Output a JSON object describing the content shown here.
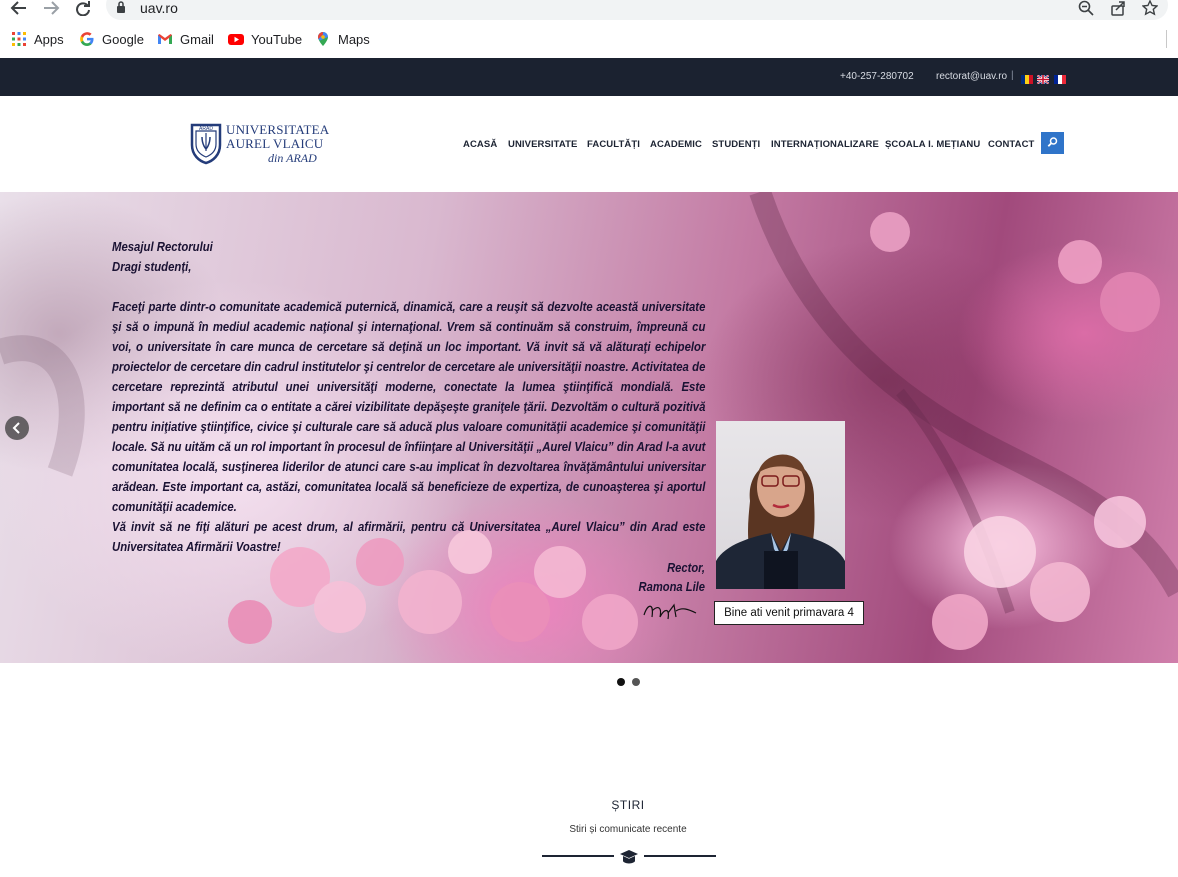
{
  "browser": {
    "url": "uav.ro",
    "bookmarks": [
      {
        "label": "Apps",
        "icon": "apps-grid-icon"
      },
      {
        "label": "Google",
        "icon": "google-icon"
      },
      {
        "label": "Gmail",
        "icon": "gmail-icon"
      },
      {
        "label": "YouTube",
        "icon": "youtube-icon"
      },
      {
        "label": "Maps",
        "icon": "maps-icon"
      }
    ]
  },
  "topbar": {
    "phone": "+40-257-280702",
    "email": "rectorat@uav.ro",
    "separator": "|",
    "languages": [
      "ro",
      "en",
      "fr"
    ]
  },
  "logo": {
    "line1": "UNIVERSITATEA",
    "line2": "AUREL VLAICU",
    "line3": "din ARAD",
    "emblem_text": "ARAD"
  },
  "menu": [
    "ACASĂ",
    "UNIVERSITATE",
    "FACULTĂȚI",
    "ACADEMIC",
    "STUDENȚI",
    "INTERNAȚIONALIZARE",
    "ȘCOALA I. MEȚIANU",
    "CONTACT"
  ],
  "hero": {
    "heading": "Mesajul Rectorului",
    "greeting": "Dragi studenți,",
    "body": "Faceţi parte dintr-o comunitate academică puternică, dinamică, care a reuşit să dezvolte această universitate şi să o impună în mediul academic naţional şi internaţional. Vrem să continuăm să construim, împreună cu voi, o universitate în care munca de cercetare să deţină un loc important. Vă invit să vă alăturaţi echipelor proiectelor de cercetare din cadrul institutelor şi centrelor de cercetare ale universităţii noastre.  Activitatea de cercetare reprezintă atributul unei universităţi moderne, conectate la lumea ştiinţifică mondială. Este important să ne definim ca o entitate a cărei vizibilitate depăşeşte graniţele ţării. Dezvoltăm o cultură pozitivă pentru iniţiative ştiinţifice, civice şi culturale care să aducă plus valoare comunităţii academice şi comunităţii locale. Să nu uităm că un rol important în procesul de înfiinţare al Universităţii „Aurel Vlaicu” din Arad l-a avut comunitatea locală, susţinerea liderilor de atunci care s-au implicat în dezvoltarea învăţământului universitar arădean. Este important ca, astăzi, comunitatea locală să beneficieze de expertiza, de cunoaşterea şi aportul comunităţii academice.",
    "closing": "Vă invit să ne fiţi alături pe acest drum, al afirmării, pentru că Universitatea „Aurel Vlaicu” din Arad este Universitatea Afirmării Voastre!",
    "signature_title": "Rector,",
    "signature_name": "Ramona Lile",
    "caption": "Bine ati venit primavara 4",
    "slide_index": 1,
    "slide_count": 2
  },
  "news": {
    "title": "ȘTIRI",
    "subtitle": "Stiri și comunicate recente",
    "divider_icon": "graduation-cap-icon"
  },
  "colors": {
    "topbar": "#1b2230",
    "brand_blue": "#243c7a",
    "search_button": "#2f74c9",
    "hero_text": "#1a1233"
  }
}
